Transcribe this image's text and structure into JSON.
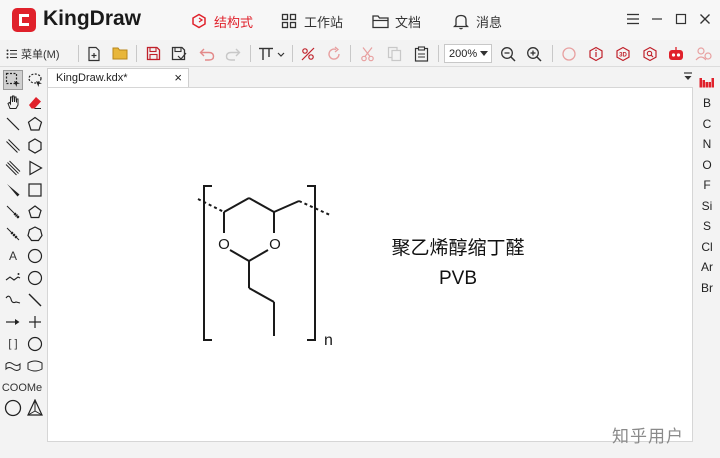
{
  "app": {
    "name": "KingDraw"
  },
  "nav": {
    "tabs": [
      {
        "label": "结构式",
        "icon": "structure-icon",
        "active": true
      },
      {
        "label": "工作站",
        "icon": "grid-icon",
        "active": false
      },
      {
        "label": "文档",
        "icon": "folder-icon",
        "active": false
      },
      {
        "label": "消息",
        "icon": "bell-icon",
        "active": false
      }
    ]
  },
  "toolbar": {
    "menu_label": "菜单(M)",
    "zoom_value": "200%"
  },
  "document": {
    "tab_name": "KingDraw.kdx*",
    "close_symbol": "×"
  },
  "canvas": {
    "repeat_subscript": "n",
    "atom_labels": [
      "O",
      "O"
    ],
    "caption_name": "聚乙烯醇缩丁醛",
    "caption_abbr": "PVB"
  },
  "palette": {
    "text_tool": "A",
    "group_tool": "COOMe",
    "bracket_tool": "[ ]"
  },
  "elements_panel": {
    "items": [
      "B",
      "C",
      "N",
      "O",
      "F",
      "Si",
      "S",
      "Cl",
      "Ar",
      "Br"
    ]
  },
  "watermark": "知乎用户",
  "colors": {
    "accent": "#e0212b",
    "canvas": "#ffffff",
    "chrome": "#f3f3f3"
  }
}
